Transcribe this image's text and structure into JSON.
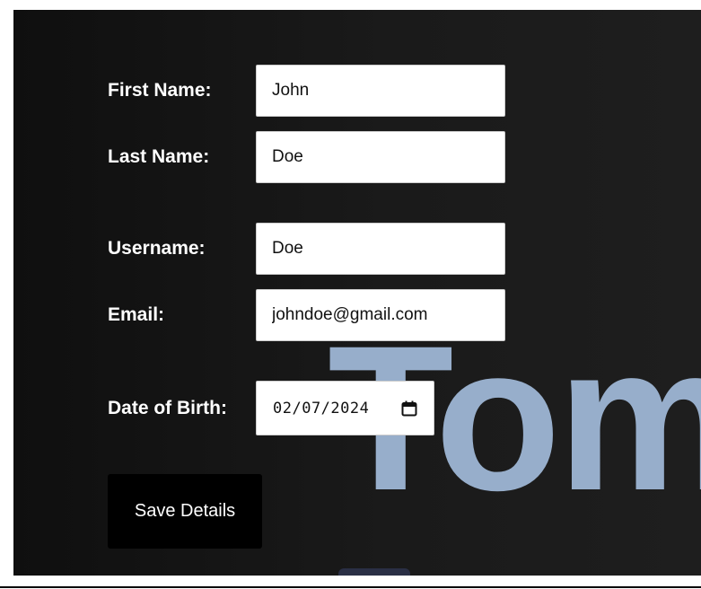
{
  "form": {
    "first_name": {
      "label": "First Name:",
      "value": "John"
    },
    "last_name": {
      "label": "Last Name:",
      "value": "Doe"
    },
    "username": {
      "label": "Username:",
      "value": "Doe"
    },
    "email": {
      "label": "Email:",
      "value": "johndoe@gmail.com"
    },
    "dob": {
      "label": "Date of Birth:",
      "value": "02/07/2024",
      "icon": "calendar-icon"
    },
    "save_label": "Save Details"
  },
  "background": {
    "text": "Tom",
    "text_color": "#97aecb"
  }
}
